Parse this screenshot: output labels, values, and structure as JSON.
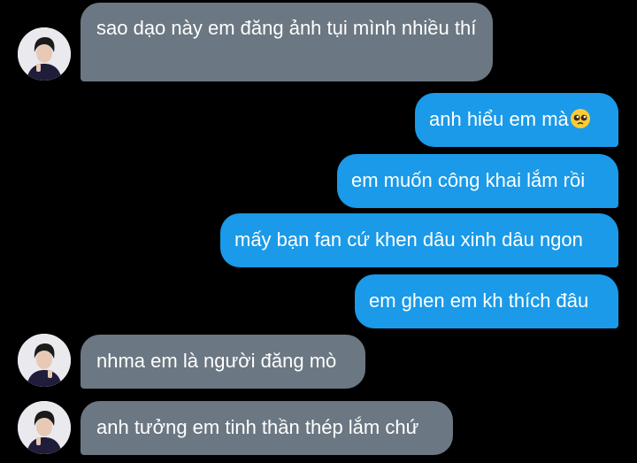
{
  "messages": [
    {
      "sender": "other",
      "text": "sao dạo này em đăng ảnh tụi mình nhiều thí"
    },
    {
      "sender": "me",
      "text": "anh hiểu em mà",
      "emoji": "pleading-face-emoji"
    },
    {
      "sender": "me",
      "text": "em muốn công khai lắm rồi"
    },
    {
      "sender": "me",
      "text": "mấy bạn fan cứ khen dâu xinh dâu ngon"
    },
    {
      "sender": "me",
      "text": "em ghen em kh thích đâu"
    },
    {
      "sender": "other",
      "text": "nhma em là người đăng mò"
    },
    {
      "sender": "other",
      "text": "anh tưởng em tinh thần thép lắm chứ"
    }
  ],
  "colors": {
    "background": "#000000",
    "incoming_bubble": "#6b7782",
    "outgoing_bubble": "#1a9ae8",
    "text": "#ffffff"
  }
}
